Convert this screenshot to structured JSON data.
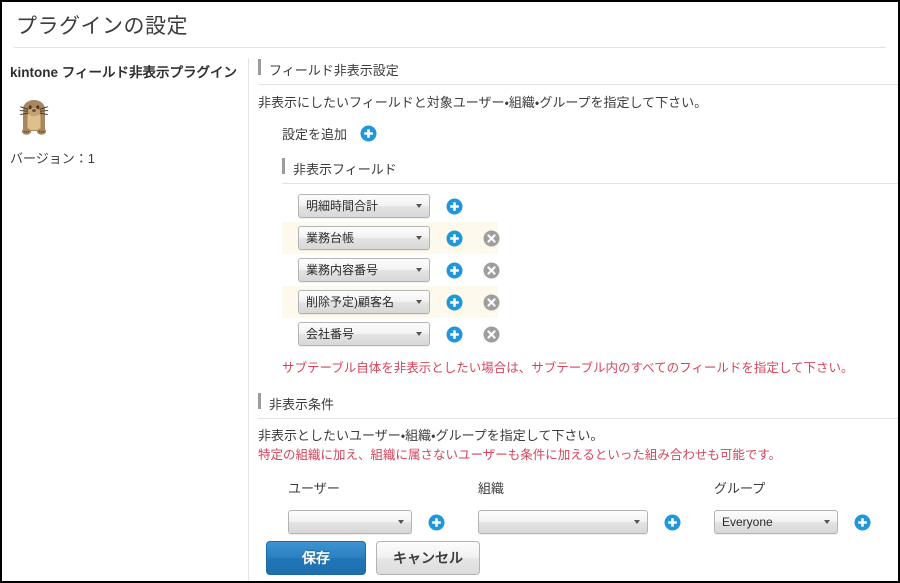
{
  "header": {
    "title": "プラグインの設定"
  },
  "sidebar": {
    "plugin_name": "kintone フィールド非表示プラグイン",
    "icon": "otter-mascot-icon",
    "version_label": "バージョン：1"
  },
  "main": {
    "section_title": "フィールド非表示設定",
    "description": "非表示にしたいフィールドと対象ユーザー・組織・グループを指定して下さい。",
    "add_setting_label": "設定を追加",
    "add_setting_icon": "plus-circle-icon",
    "hidden_fields": {
      "section_title": "非表示フィールド",
      "rows": [
        {
          "value": "明細時間合計",
          "highlight": false,
          "has_delete": false
        },
        {
          "value": "業務台帳",
          "highlight": true,
          "has_delete": true
        },
        {
          "value": "業務内容番号",
          "highlight": false,
          "has_delete": true
        },
        {
          "value": "削除予定)顧客名",
          "highlight": true,
          "has_delete": true
        },
        {
          "value": "会社番号",
          "highlight": false,
          "has_delete": true
        }
      ],
      "warning": "サブテーブル自体を非表示としたい場合は、サブテーブル内のすべてのフィールドを指定して下さい。"
    },
    "conditions": {
      "section_title": "非表示条件",
      "description": "非表示としたいユーザー・組織・グループを指定して下さい。",
      "warning": "特定の組織に加え、組織に属さないユーザーも条件に加えるといった組み合わせも可能です。",
      "columns": [
        {
          "label": "ユーザー",
          "value": ""
        },
        {
          "label": "組織",
          "value": ""
        },
        {
          "label": "グループ",
          "value": "Everyone"
        }
      ]
    }
  },
  "footer": {
    "save_label": "保存",
    "cancel_label": "キャンセル"
  },
  "icons": {
    "plus": "plus-circle-icon",
    "delete": "delete-circle-icon",
    "chevron": "chevron-down-icon"
  },
  "colors": {
    "accent_blue": "#2196d8",
    "warning_red": "#d6455c",
    "highlight_row": "#fdf9ec",
    "delete_gray": "#9e9e9e",
    "save_button": "#2a7fc0"
  }
}
